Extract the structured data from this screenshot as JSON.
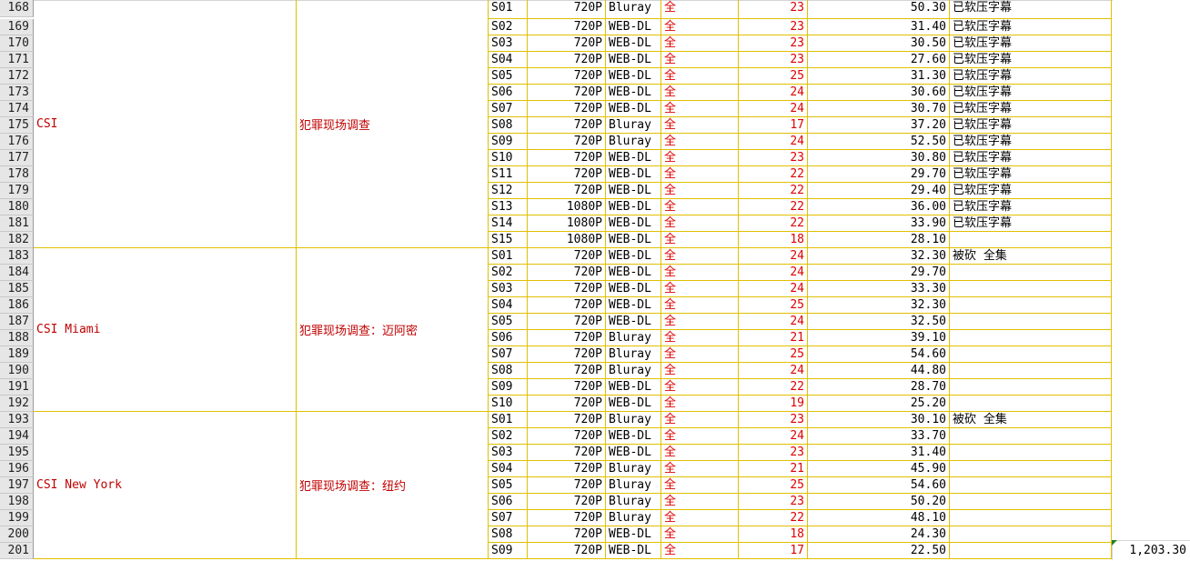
{
  "groups": [
    {
      "start": 168,
      "end": 182,
      "english_title": "CSI",
      "chinese_title": "犯罪现场调查"
    },
    {
      "start": 183,
      "end": 192,
      "english_title": "CSI Miami",
      "chinese_title": "犯罪现场调查：迈阿密"
    },
    {
      "start": 193,
      "end": 201,
      "english_title": "CSI New York",
      "chinese_title": "犯罪现场调查：纽约"
    }
  ],
  "rows": [
    {
      "row": "168",
      "season": "S01",
      "res": "720P",
      "source": "Bluray",
      "status": "全",
      "eps": "23",
      "size": "50.30",
      "note": "已软压字幕"
    },
    {
      "row": "169",
      "season": "S02",
      "res": "720P",
      "source": "WEB-DL",
      "status": "全",
      "eps": "23",
      "size": "31.40",
      "note": "已软压字幕"
    },
    {
      "row": "170",
      "season": "S03",
      "res": "720P",
      "source": "WEB-DL",
      "status": "全",
      "eps": "23",
      "size": "30.50",
      "note": "已软压字幕"
    },
    {
      "row": "171",
      "season": "S04",
      "res": "720P",
      "source": "WEB-DL",
      "status": "全",
      "eps": "23",
      "size": "27.60",
      "note": "已软压字幕"
    },
    {
      "row": "172",
      "season": "S05",
      "res": "720P",
      "source": "WEB-DL",
      "status": "全",
      "eps": "25",
      "size": "31.30",
      "note": "已软压字幕"
    },
    {
      "row": "173",
      "season": "S06",
      "res": "720P",
      "source": "WEB-DL",
      "status": "全",
      "eps": "24",
      "size": "30.60",
      "note": "已软压字幕"
    },
    {
      "row": "174",
      "season": "S07",
      "res": "720P",
      "source": "WEB-DL",
      "status": "全",
      "eps": "24",
      "size": "30.70",
      "note": "已软压字幕"
    },
    {
      "row": "175",
      "season": "S08",
      "res": "720P",
      "source": "Bluray",
      "status": "全",
      "eps": "17",
      "size": "37.20",
      "note": "已软压字幕"
    },
    {
      "row": "176",
      "season": "S09",
      "res": "720P",
      "source": "Bluray",
      "status": "全",
      "eps": "24",
      "size": "52.50",
      "note": "已软压字幕"
    },
    {
      "row": "177",
      "season": "S10",
      "res": "720P",
      "source": "WEB-DL",
      "status": "全",
      "eps": "23",
      "size": "30.80",
      "note": "已软压字幕"
    },
    {
      "row": "178",
      "season": "S11",
      "res": "720P",
      "source": "WEB-DL",
      "status": "全",
      "eps": "22",
      "size": "29.70",
      "note": "已软压字幕"
    },
    {
      "row": "179",
      "season": "S12",
      "res": "720P",
      "source": "WEB-DL",
      "status": "全",
      "eps": "22",
      "size": "29.40",
      "note": "已软压字幕"
    },
    {
      "row": "180",
      "season": "S13",
      "res": "1080P",
      "source": "WEB-DL",
      "status": "全",
      "eps": "22",
      "size": "36.00",
      "note": "已软压字幕"
    },
    {
      "row": "181",
      "season": "S14",
      "res": "1080P",
      "source": "WEB-DL",
      "status": "全",
      "eps": "22",
      "size": "33.90",
      "note": "已软压字幕"
    },
    {
      "row": "182",
      "season": "S15",
      "res": "1080P",
      "source": "WEB-DL",
      "status": "全",
      "eps": "18",
      "size": "28.10",
      "note": ""
    },
    {
      "row": "183",
      "season": "S01",
      "res": "720P",
      "source": "WEB-DL",
      "status": "全",
      "eps": "24",
      "size": "32.30",
      "note": "被砍 全集"
    },
    {
      "row": "184",
      "season": "S02",
      "res": "720P",
      "source": "WEB-DL",
      "status": "全",
      "eps": "24",
      "size": "29.70",
      "note": ""
    },
    {
      "row": "185",
      "season": "S03",
      "res": "720P",
      "source": "WEB-DL",
      "status": "全",
      "eps": "24",
      "size": "33.30",
      "note": ""
    },
    {
      "row": "186",
      "season": "S04",
      "res": "720P",
      "source": "WEB-DL",
      "status": "全",
      "eps": "25",
      "size": "32.30",
      "note": ""
    },
    {
      "row": "187",
      "season": "S05",
      "res": "720P",
      "source": "WEB-DL",
      "status": "全",
      "eps": "24",
      "size": "32.50",
      "note": ""
    },
    {
      "row": "188",
      "season": "S06",
      "res": "720P",
      "source": "Bluray",
      "status": "全",
      "eps": "21",
      "size": "39.10",
      "note": ""
    },
    {
      "row": "189",
      "season": "S07",
      "res": "720P",
      "source": "Bluray",
      "status": "全",
      "eps": "25",
      "size": "54.60",
      "note": ""
    },
    {
      "row": "190",
      "season": "S08",
      "res": "720P",
      "source": "Bluray",
      "status": "全",
      "eps": "24",
      "size": "44.80",
      "note": ""
    },
    {
      "row": "191",
      "season": "S09",
      "res": "720P",
      "source": "WEB-DL",
      "status": "全",
      "eps": "22",
      "size": "28.70",
      "note": ""
    },
    {
      "row": "192",
      "season": "S10",
      "res": "720P",
      "source": "WEB-DL",
      "status": "全",
      "eps": "19",
      "size": "25.20",
      "note": ""
    },
    {
      "row": "193",
      "season": "S01",
      "res": "720P",
      "source": "Bluray",
      "status": "全",
      "eps": "23",
      "size": "30.10",
      "note": "被砍 全集"
    },
    {
      "row": "194",
      "season": "S02",
      "res": "720P",
      "source": "WEB-DL",
      "status": "全",
      "eps": "24",
      "size": "33.70",
      "note": ""
    },
    {
      "row": "195",
      "season": "S03",
      "res": "720P",
      "source": "WEB-DL",
      "status": "全",
      "eps": "23",
      "size": "31.40",
      "note": ""
    },
    {
      "row": "196",
      "season": "S04",
      "res": "720P",
      "source": "Bluray",
      "status": "全",
      "eps": "21",
      "size": "45.90",
      "note": ""
    },
    {
      "row": "197",
      "season": "S05",
      "res": "720P",
      "source": "Bluray",
      "status": "全",
      "eps": "25",
      "size": "54.60",
      "note": ""
    },
    {
      "row": "198",
      "season": "S06",
      "res": "720P",
      "source": "Bluray",
      "status": "全",
      "eps": "23",
      "size": "50.20",
      "note": ""
    },
    {
      "row": "199",
      "season": "S07",
      "res": "720P",
      "source": "Bluray",
      "status": "全",
      "eps": "22",
      "size": "48.10",
      "note": ""
    },
    {
      "row": "200",
      "season": "S08",
      "res": "720P",
      "source": "WEB-DL",
      "status": "全",
      "eps": "18",
      "size": "24.30",
      "note": ""
    },
    {
      "row": "201",
      "season": "S09",
      "res": "720P",
      "source": "WEB-DL",
      "status": "全",
      "eps": "17",
      "size": "22.50",
      "note": ""
    }
  ],
  "total_cell": "1,203.30",
  "colors": {
    "grid_line": "#e0c000",
    "title_text": "#c00000",
    "status_text": "#e00000",
    "header_bg": "#e6e6e6"
  }
}
